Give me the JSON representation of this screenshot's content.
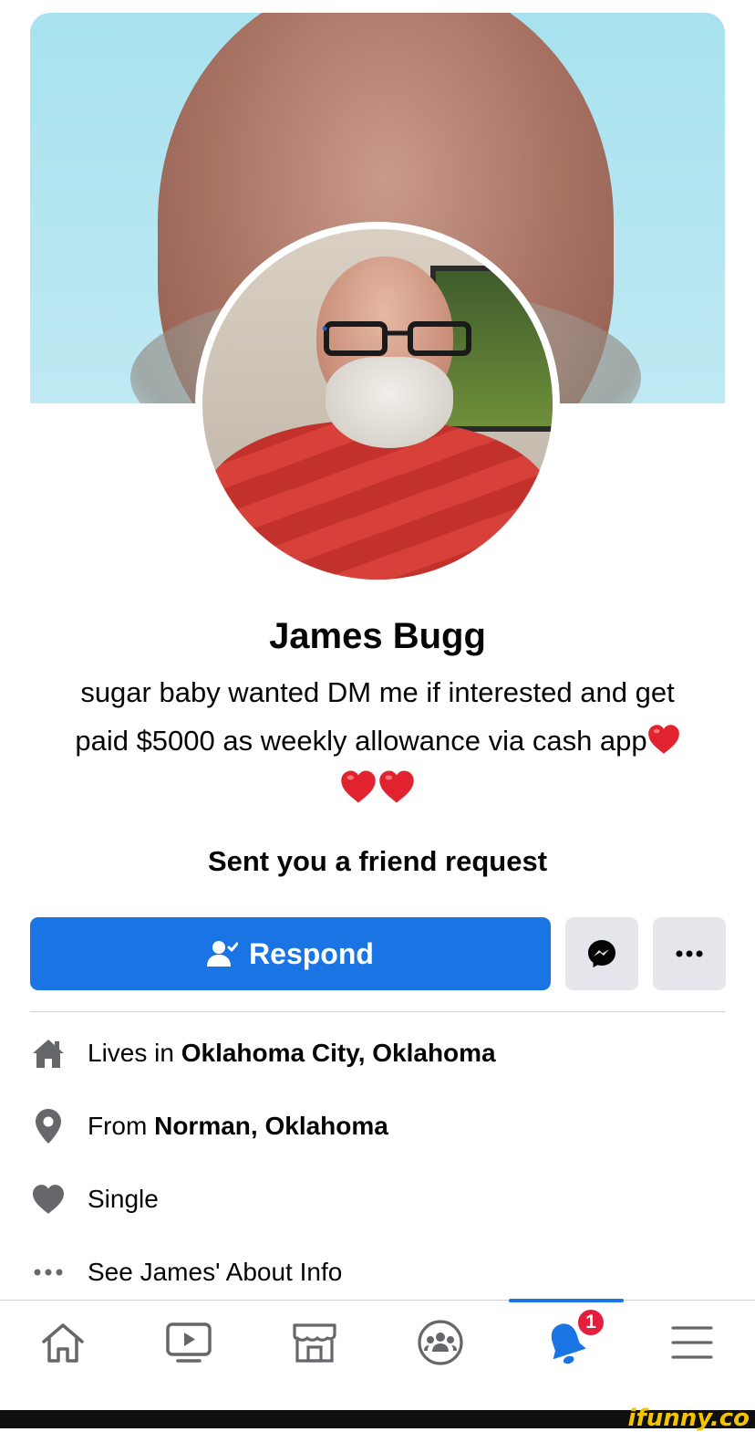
{
  "profile": {
    "name": "James Bugg",
    "bio_line1": "sugar baby wanted DM me if interested and get",
    "bio_line2": "paid $5000 as weekly allowance via cash app",
    "request_status": "Sent you a friend request"
  },
  "actions": {
    "respond_label": "Respond",
    "messenger_icon": "messenger-icon",
    "more_icon": "more-dots-icon"
  },
  "about": {
    "lives_in_prefix": "Lives in",
    "lives_in_value": "Oklahoma City, Oklahoma",
    "from_prefix": "From",
    "from_value": "Norman, Oklahoma",
    "relationship": "Single",
    "see_about": "See James' About Info"
  },
  "tabbar": {
    "tabs": [
      "home-icon",
      "watch-icon",
      "marketplace-icon",
      "groups-icon",
      "notifications-icon",
      "menu-icon"
    ],
    "active": "notifications-icon",
    "notification_count": "1"
  },
  "watermark": "ifunny.co",
  "colors": {
    "primary": "#1b74e4",
    "secondary_button": "#e4e6eb",
    "badge": "#e41e3f",
    "heart": "#e0232e"
  }
}
